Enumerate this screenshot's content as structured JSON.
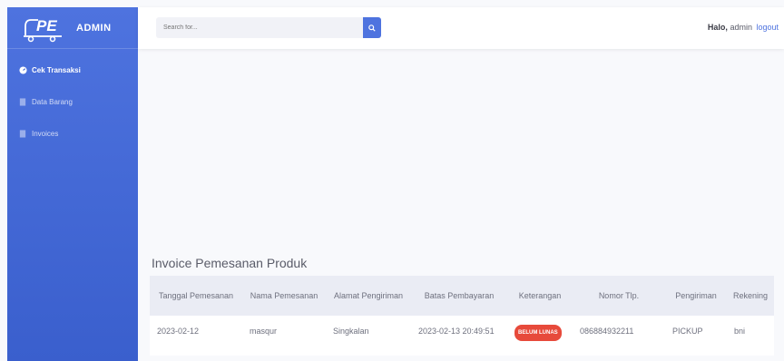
{
  "brand": {
    "logo_text": "PE",
    "title": "ADMIN"
  },
  "sidebar": {
    "items": [
      {
        "label": "Cek Transaksi",
        "icon": "tachometer-icon"
      },
      {
        "label": "Data Barang",
        "icon": "document-icon"
      },
      {
        "label": "Invoices",
        "icon": "document-icon"
      }
    ]
  },
  "search": {
    "placeholder": "Search for..."
  },
  "user": {
    "greeting": "Halo,",
    "name": "admin",
    "logout": "logout"
  },
  "content": {
    "title": "Invoice Pemesanan Produk"
  },
  "table": {
    "headers": [
      "Tanggal Pemesanan",
      "Nama Pemesanan",
      "Alamat Pengiriman",
      "Batas Pembayaran",
      "Keterangan",
      "Nomor Tlp.",
      "Pengiriman",
      "Rekening"
    ],
    "rows": [
      [
        "2023-02-12",
        "masqur",
        "Singkalan",
        "2023-02-13 20:49:51",
        "BELUM LUNAS",
        "086884932211",
        "PICKUP",
        "bni"
      ]
    ]
  },
  "colors": {
    "primary": "#4e73df",
    "danger": "#e74a3b"
  }
}
